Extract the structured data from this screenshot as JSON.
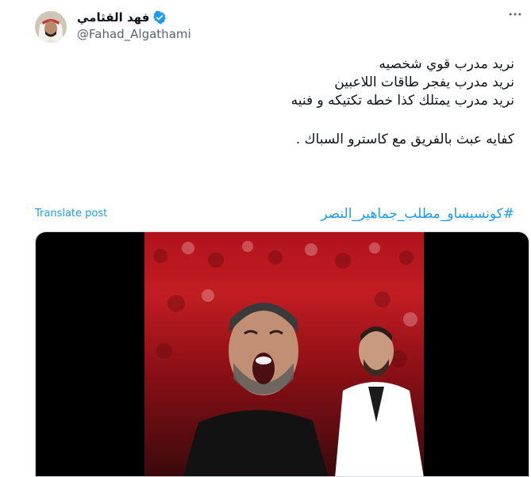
{
  "author": {
    "display_name": "فهد القثامي",
    "handle": "@Fahad_Algathami",
    "verified": true
  },
  "post": {
    "lines": [
      "نريد مدرب قوي شخصيه",
      "نريد مدرب يفجر طاقات اللاعبين",
      "نريد مدرب يمتلك كذا خطه تكتيكه و فنيه",
      "كفايه عبث بالفريق مع كاسترو السباك ."
    ],
    "hashtag": "#كونسيساو_مطلب_جماهير_النصر",
    "translate_label": "Translate post"
  },
  "icons": {
    "more": "more-horizontal-icon",
    "verified": "verified-badge-icon"
  },
  "colors": {
    "link": "#1d9bf0",
    "secondary_text": "#536471",
    "primary_text": "#0f1419"
  }
}
